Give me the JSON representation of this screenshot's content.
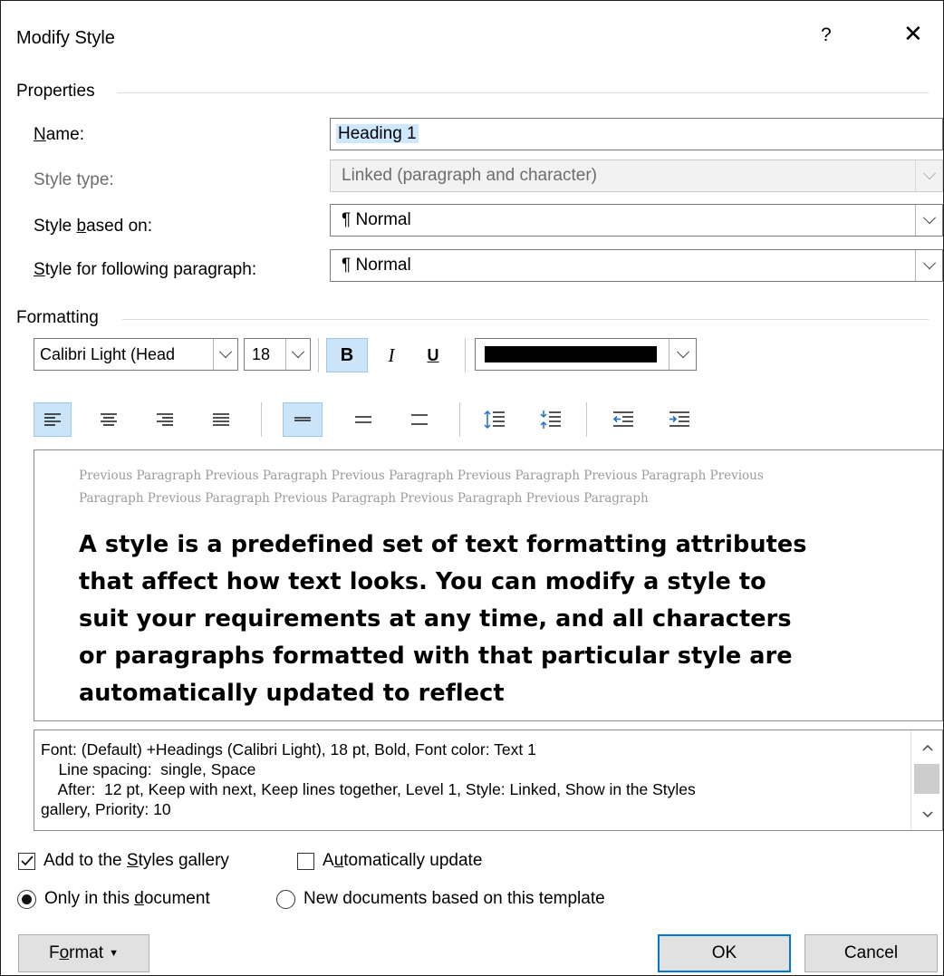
{
  "dialog": {
    "title": "Modify Style",
    "help": "?",
    "close": "✕"
  },
  "properties": {
    "group_label": "Properties",
    "name_label": "Name:",
    "name_value": "Heading 1",
    "style_type_label": "Style type:",
    "style_type_value": "Linked (paragraph and character)",
    "based_on_label": "Style based on:",
    "based_on_value": "¶  Normal",
    "following_label": "Style for following paragraph:",
    "following_value": "¶  Normal"
  },
  "formatting": {
    "group_label": "Formatting",
    "font_name": "Calibri Light (Head",
    "font_size": "18",
    "bold": "B",
    "italic": "I",
    "underline": "U",
    "font_color": "#000000"
  },
  "preview": {
    "previous_line_1": "Previous Paragraph Previous Paragraph Previous Paragraph Previous Paragraph Previous Paragraph Previous",
    "previous_line_2": "Paragraph Previous Paragraph Previous Paragraph Previous Paragraph Previous Paragraph",
    "main_line_1": "A style is a predefined set of text formatting attributes",
    "main_line_2": "that affect how text looks. You can modify a style to",
    "main_line_3": "suit your requirements at any time, and all characters",
    "main_line_4": "or paragraphs formatted with that particular style are",
    "main_line_5": "automatically updated to reflect"
  },
  "description": {
    "line_1": "Font: (Default) +Headings (Calibri Light), 18 pt, Bold, Font color: Text 1",
    "line_2": "    Line spacing:  single, Space",
    "line_3": "    After:  12 pt, Keep with next, Keep lines together, Level 1, Style: Linked, Show in the Styles",
    "line_4": "gallery, Priority: 10"
  },
  "options": {
    "add_gallery_pre": "Add to the ",
    "add_gallery_key": "S",
    "add_gallery_post": "tyles gallery",
    "add_gallery_checked": true,
    "auto_update_pre": "A",
    "auto_update_key": "u",
    "auto_update_post": "tomatically update",
    "auto_update_checked": false,
    "only_doc_pre": "Only in this ",
    "only_doc_key": "d",
    "only_doc_post": "ocument",
    "new_docs": "New documents based on this template",
    "selected_scope": "only_doc"
  },
  "buttons": {
    "format_pre": "F",
    "format_key": "o",
    "format_post": "rmat",
    "ok": "OK",
    "cancel": "Cancel"
  },
  "colors": {
    "accent": "#0078d7",
    "selection": "#cde8ff",
    "toolbar_active": "#cce4f7"
  }
}
